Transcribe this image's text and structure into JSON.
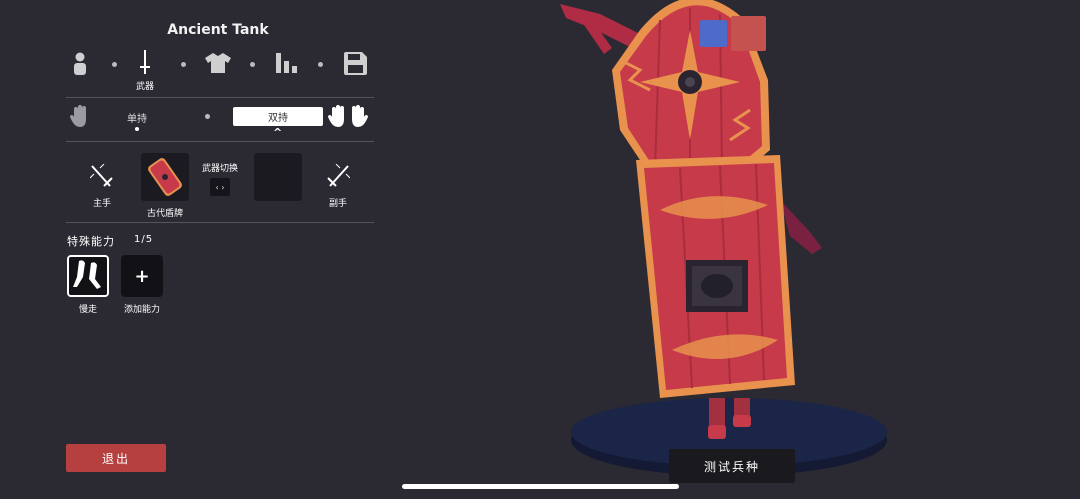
{
  "unit_title": "Ancient Tank",
  "categories": [
    {
      "icon": "unit-body-icon",
      "label": ""
    },
    {
      "icon": "sword-icon",
      "label": "武器"
    },
    {
      "icon": "shirt-icon",
      "label": ""
    },
    {
      "icon": "stats-icon",
      "label": ""
    },
    {
      "icon": "save-icon",
      "label": ""
    }
  ],
  "hand_modes": {
    "single": "单持",
    "dual": "双持"
  },
  "weapons": {
    "main_hand_label": "主手",
    "main_weapon_label": "古代盾牌",
    "switch_label": "武器切换",
    "switch_button": "‹ ›",
    "off_hand_label": "副手"
  },
  "abilities": {
    "title": "特殊能力",
    "count": "1/5",
    "items": [
      {
        "icon": "slow-walk-icon",
        "label": "慢走"
      },
      {
        "icon": "plus-icon",
        "label": "添加能力"
      }
    ]
  },
  "buttons": {
    "exit": "退出",
    "test_unit": "测试兵种"
  },
  "colors": {
    "background": "#2b2a33",
    "team_blue": "#4f6bc9",
    "team_red": "#c4534f",
    "exit_red": "#b5403f",
    "shield_red": "#c63a4a",
    "shield_trim": "#e8924e",
    "platform": "#1b2547"
  }
}
